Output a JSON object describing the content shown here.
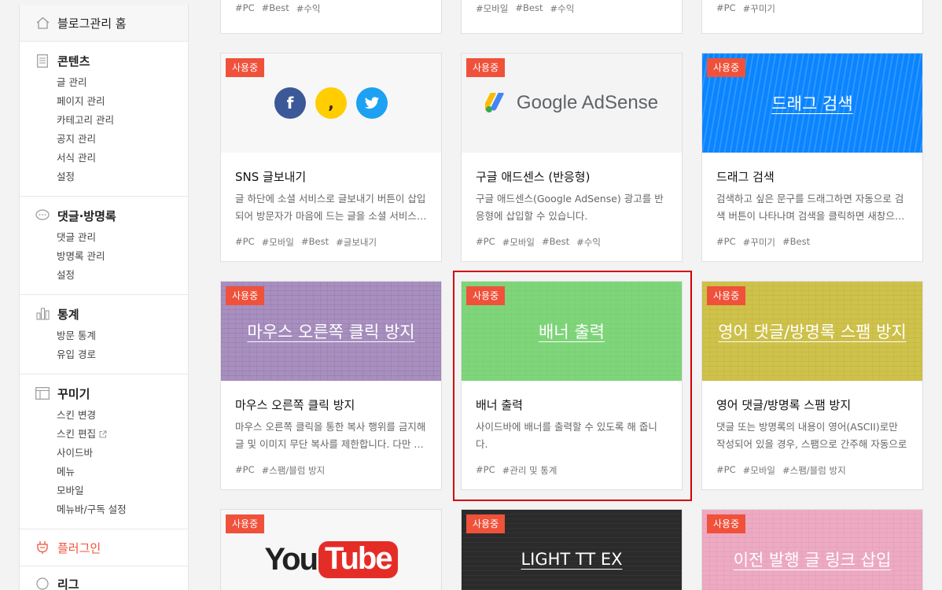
{
  "sidebar": {
    "home": "블로그관리 홈",
    "content": {
      "title": "콘텐츠",
      "items": [
        "글 관리",
        "페이지 관리",
        "카테고리 관리",
        "공지 관리",
        "서식 관리",
        "설정"
      ]
    },
    "comments": {
      "title": "댓글·방명록",
      "items": [
        "댓글 관리",
        "방명록 관리",
        "설정"
      ]
    },
    "stats": {
      "title": "통계",
      "items": [
        "방문 통계",
        "유입 경로"
      ]
    },
    "decorate": {
      "title": "꾸미기",
      "items": [
        "스킨 변경",
        "스킨 편집",
        "사이드바",
        "메뉴",
        "모바일",
        "메뉴바/구독 설정"
      ]
    },
    "plugin": {
      "title": "플러그인"
    },
    "next": {
      "title": "리그"
    }
  },
  "badge_label": "사용중",
  "top_tags": [
    [
      "#PC",
      "#Best",
      "#수익"
    ],
    [
      "#모바일",
      "#Best",
      "#수익"
    ],
    [
      "#PC",
      "#꾸미기"
    ]
  ],
  "cards": [
    {
      "title": "SNS 글보내기",
      "desc": "글 하단에 소셜 서비스로 글보내기 버튼이 삽입되어 방문자가 마음에 드는 글을 소셜 서비스…",
      "tags": [
        "#PC",
        "#모바일",
        "#Best",
        "#글보내기"
      ]
    },
    {
      "title": "구글 애드센스 (반응형)",
      "desc": "구글 애드센스(Google AdSense) 광고를 반응형에 삽입할 수 있습니다.",
      "tags": [
        "#PC",
        "#모바일",
        "#Best",
        "#수익"
      ],
      "logo_text": "Google AdSense"
    },
    {
      "title": "드래그 검색",
      "desc": "검색하고 싶은 문구를 드래그하면 자동으로 검색 버튼이 나타나며 검색을 클릭하면 새창으…",
      "tags": [
        "#PC",
        "#꾸미기",
        "#Best"
      ],
      "thumb_text": "드래그 검색",
      "color": "#0a84ff"
    },
    {
      "title": "마우스 오른쪽 클릭 방지",
      "desc": "마우스 오른쪽 클릭을 통한 복사 행위를 금지해 글 및 이미지 무단 복사를 제한합니다. 다만 …",
      "tags": [
        "#PC",
        "#스팸/블럼 방지"
      ],
      "thumb_text": "마우스 오른쪽 클릭 방지",
      "color": "#a88fc0"
    },
    {
      "title": "배너 출력",
      "desc": "사이드바에 배너를 출력할 수 있도록 해 줍니다.",
      "tags": [
        "#PC",
        "#관리 및 통계"
      ],
      "thumb_text": "배너 출력",
      "color": "#7fd67a"
    },
    {
      "title": "영어 댓글/방명록 스팸 방지",
      "desc": "댓글 또는 방명록의 내용이 영어(ASCII)로만 작성되어 있을 경우, 스팸으로 간주해 자동으로 …",
      "tags": [
        "#PC",
        "#모바일",
        "#스팸/블럼 방지"
      ],
      "thumb_text": "영어 댓글/방명록 스팸 방지",
      "color": "#cfc24a"
    }
  ],
  "bottom_cards": [
    {
      "logo_text_you": "You",
      "logo_text_tube": "Tube"
    },
    {
      "thumb_text": "LIGHT TT EX",
      "color": "#2b2b2b"
    },
    {
      "thumb_text": "이전 발행 글 링크 삽입",
      "color": "#eeaac3"
    }
  ]
}
